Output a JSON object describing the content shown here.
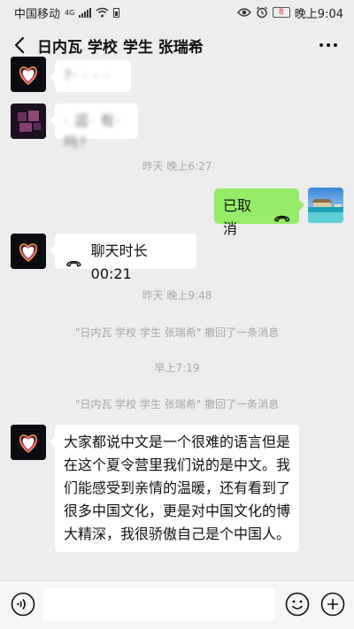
{
  "status_bar": {
    "carrier": "中国移动",
    "network": "4G",
    "battery": "8",
    "time": "晚上9:04"
  },
  "header": {
    "title": "日内瓦 学校 学生 张瑞希"
  },
  "messages": {
    "m1_text": "?· · · ·",
    "m2_text": "· 逗· 有· 吗?",
    "time1": "昨天 晚上6:27",
    "m3_text": "已取消",
    "m4_text": "聊天时长 00:21",
    "time2": "昨天 晚上9:48",
    "recall1": "\"日内瓦 学校 学生 张瑞希\" 撤回了一条消息",
    "time3": "早上7:19",
    "recall2": "\"日内瓦 学校 学生 张瑞希\" 撤回了一条消息",
    "m5_text": "大家都说中文是一个很难的语言但是在这个夏令营里我们说的是中文。我们能感受到亲情的温暖，还有看到了很多中国文化，更是对中国文化的博大精深，我很骄傲自己是个中国人。"
  },
  "colors": {
    "green_bubble": "#95ec69",
    "background": "#ededed"
  },
  "icons": {
    "back": "chevron-left-icon",
    "more": "more-dots-icon",
    "phone": "phone-hangup-icon",
    "voice": "voice-icon",
    "emoji": "emoji-icon",
    "plus": "plus-icon"
  }
}
